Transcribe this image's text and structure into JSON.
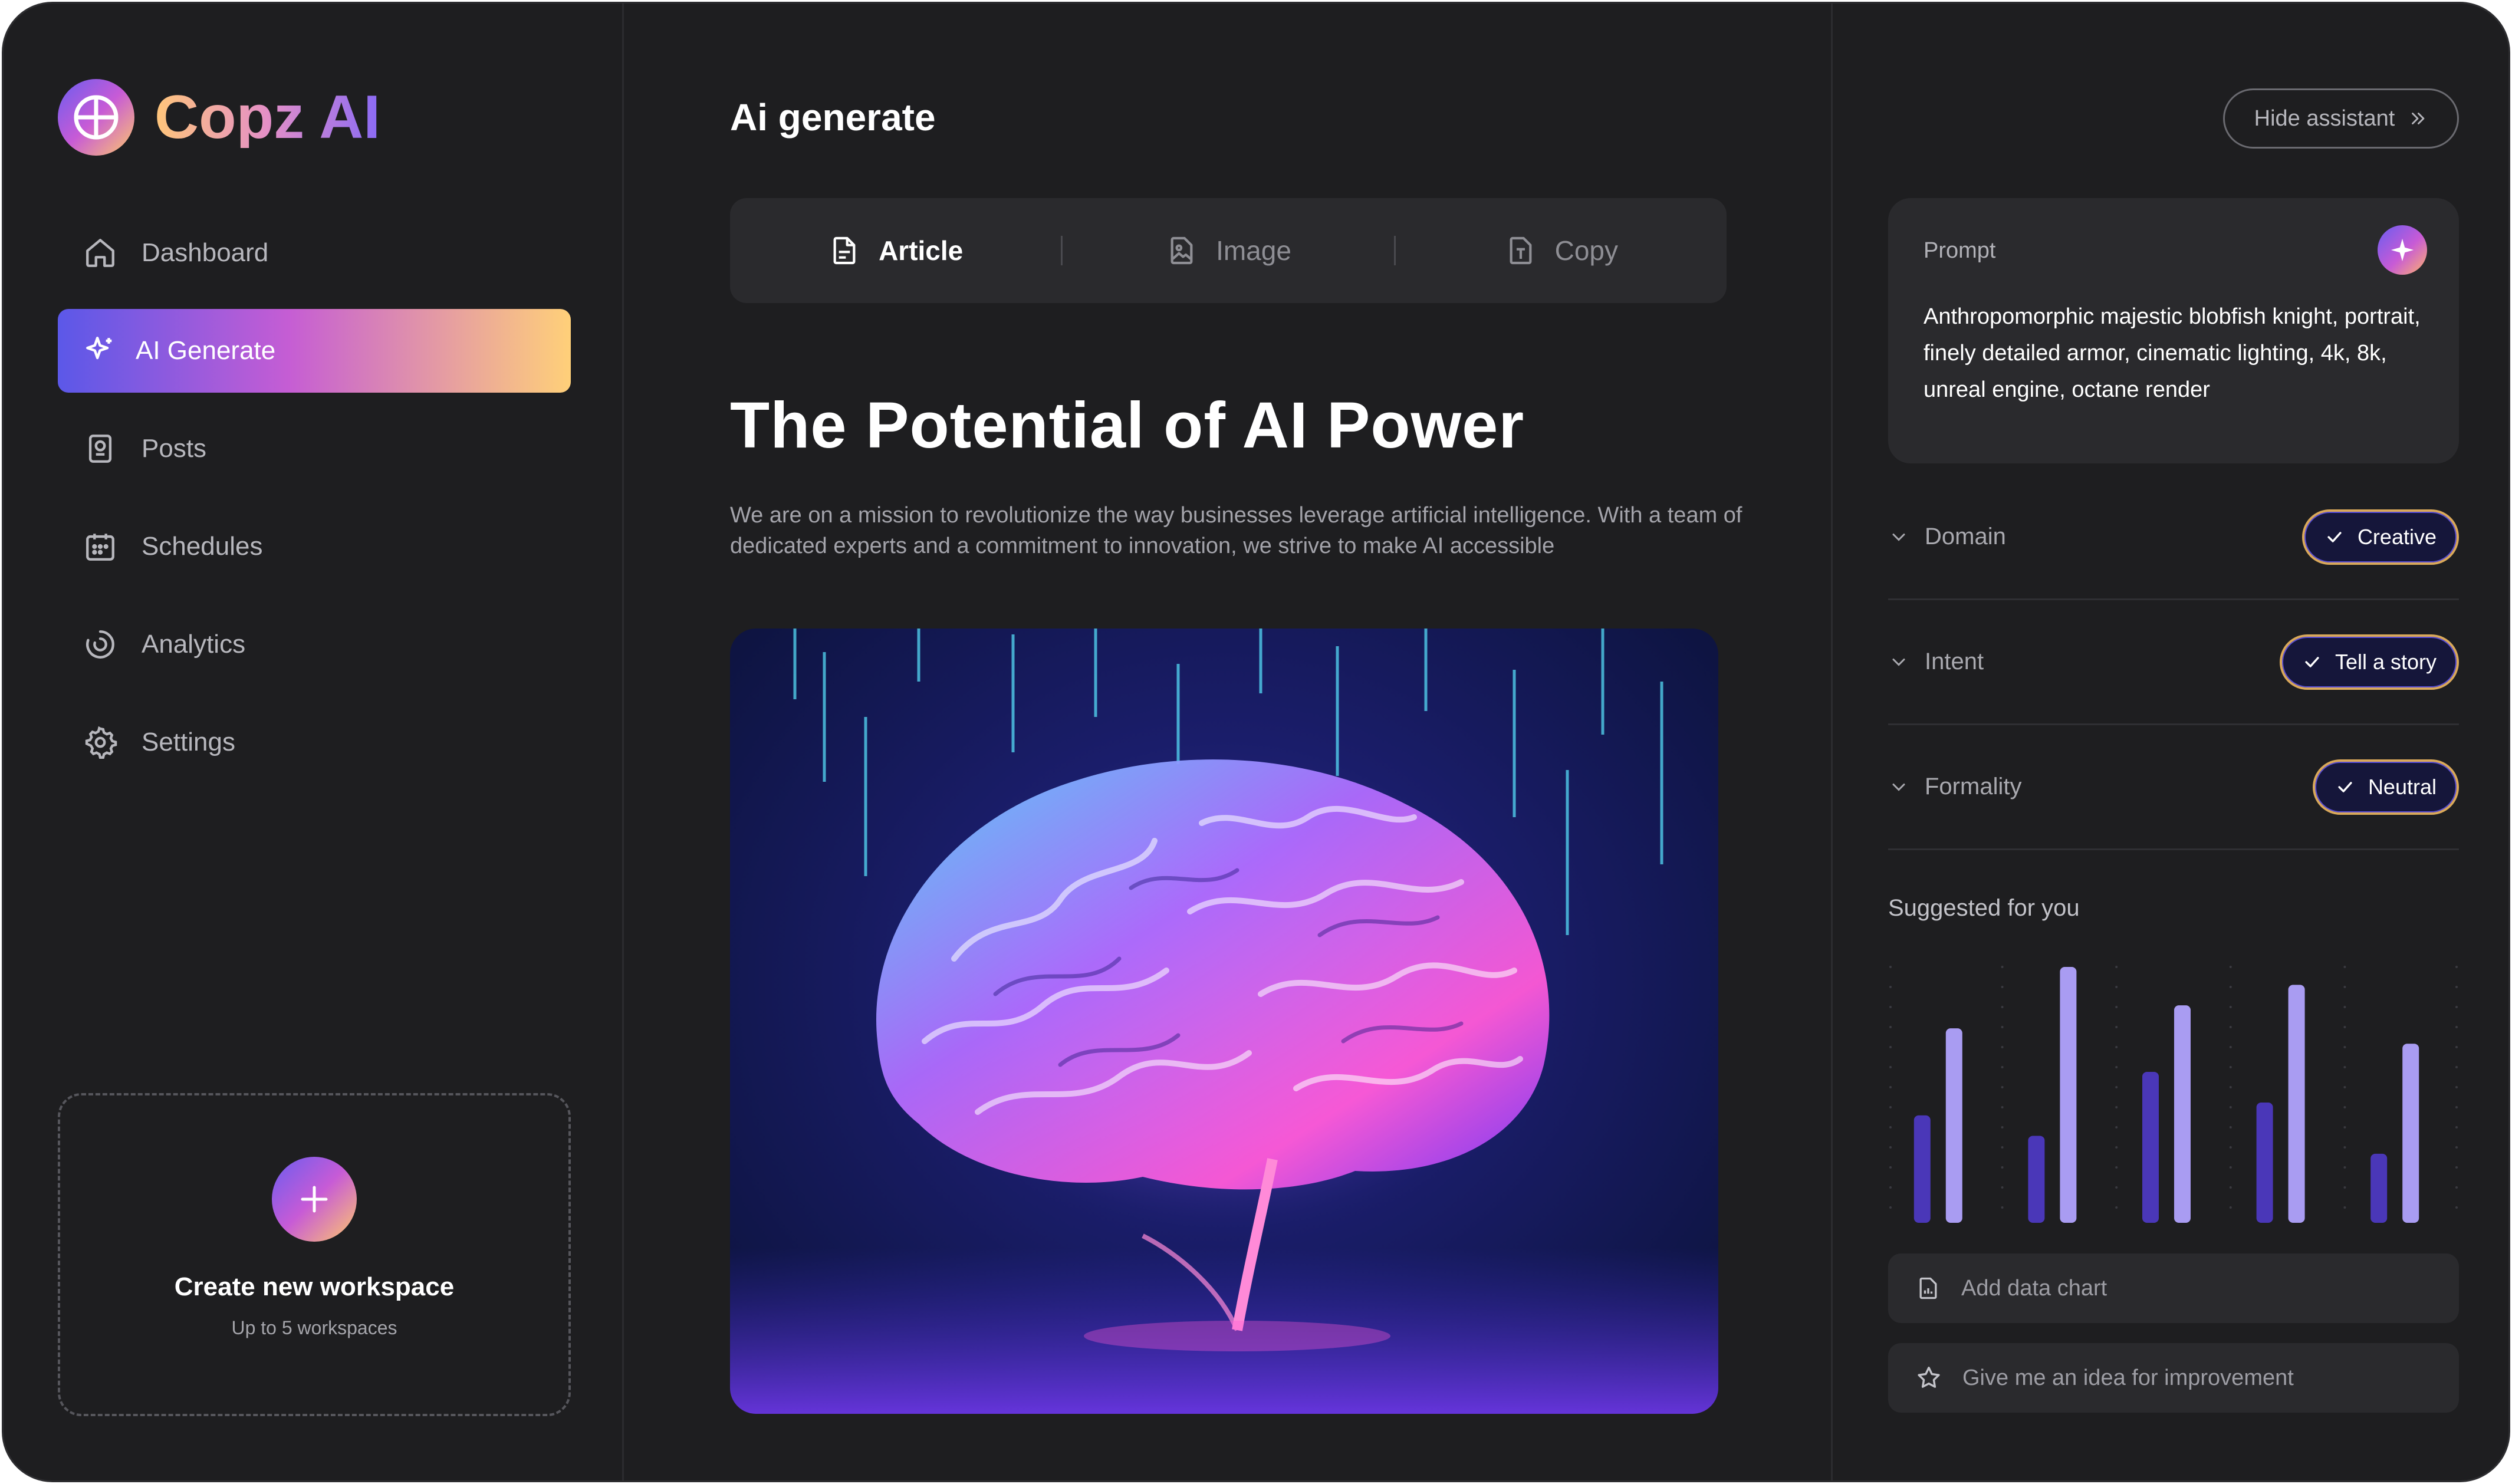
{
  "app": {
    "name": "Copz AI"
  },
  "sidebar": {
    "items": [
      {
        "label": "Dashboard",
        "icon": "home-icon",
        "active": false
      },
      {
        "label": "AI Generate",
        "icon": "sparkle-icon",
        "active": true
      },
      {
        "label": "Posts",
        "icon": "posts-icon",
        "active": false
      },
      {
        "label": "Schedules",
        "icon": "calendar-icon",
        "active": false
      },
      {
        "label": "Analytics",
        "icon": "analytics-icon",
        "active": false
      },
      {
        "label": "Settings",
        "icon": "gear-icon",
        "active": false
      }
    ],
    "workspace": {
      "title": "Create new workspace",
      "subtitle": "Up to 5 workspaces"
    }
  },
  "main": {
    "title": "Ai generate",
    "tabs": [
      {
        "label": "Article",
        "icon": "document-icon",
        "active": true
      },
      {
        "label": "Image",
        "icon": "image-file-icon",
        "active": false
      },
      {
        "label": "Copy",
        "icon": "text-file-icon",
        "active": false
      }
    ],
    "headline": "The Potential of AI Power",
    "description": "We are on a mission to revolutionize the way businesses leverage artificial intelligence. With a team of dedicated experts and a commitment to innovation, we strive to make AI accessible"
  },
  "assistant": {
    "hide_label": "Hide assistant",
    "prompt_label": "Prompt",
    "prompt_text": "Anthropomorphic majestic blobfish knight, portrait, finely detailed armor, cinematic lighting, 4k, 8k, unreal engine, octane render",
    "options": [
      {
        "label": "Domain",
        "value": "Creative"
      },
      {
        "label": "Intent",
        "value": "Tell a story"
      },
      {
        "label": "Formality",
        "value": "Neutral"
      }
    ],
    "suggested_title": "Suggested for you",
    "actions": [
      {
        "label": "Add data chart",
        "icon": "chart-file-icon"
      },
      {
        "label": "Give me an idea for improvement",
        "icon": "star-icon"
      }
    ]
  },
  "colors": {
    "background": "#1e1e20",
    "panel": "#2a2a2d",
    "accent_purple": "#5b58e8",
    "accent_pink": "#c55dd4",
    "accent_gold": "#ffd079",
    "bar_dark": "#4a37b8",
    "bar_light": "#a99cf2"
  },
  "chart_data": {
    "type": "bar",
    "title": "",
    "categories": [
      "",
      "",
      "",
      "",
      ""
    ],
    "series": [
      {
        "values": [
          0.42,
          0.34,
          0.59,
          0.47,
          0.27
        ]
      },
      {
        "values": [
          0.76,
          1.0,
          0.85,
          0.93,
          0.7
        ]
      }
    ],
    "ylim": [
      0,
      1
    ],
    "grid": true,
    "legend": "none"
  }
}
